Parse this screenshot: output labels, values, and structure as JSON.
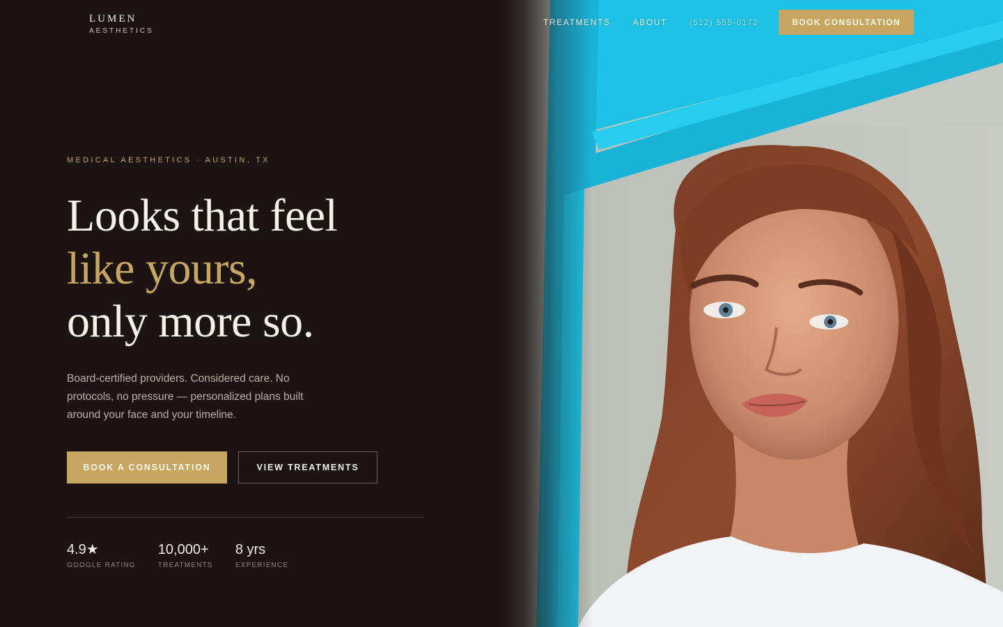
{
  "brand": {
    "name": "LUMEN",
    "subtitle": "AESTHETICS"
  },
  "nav": {
    "items": [
      {
        "label": "TREATMENTS"
      },
      {
        "label": "ABOUT"
      },
      {
        "label": "(512) 555-0172"
      }
    ],
    "cta_label": "BOOK CONSULTATION"
  },
  "hero": {
    "eyebrow": "MEDICAL AESTHETICS · AUSTIN, TX",
    "headline_line1": "Looks that feel",
    "headline_line2": "like yours,",
    "headline_line3": "only more so.",
    "lede": "Board-certified providers. Considered care. No protocols, no pressure — personalized plans built around your face and your timeline.",
    "primary_button": "BOOK A CONSULTATION",
    "secondary_button": "VIEW TREATMENTS"
  },
  "stats": [
    {
      "value": "4.9★",
      "label": "GOOGLE RATING"
    },
    {
      "value": "10,000+",
      "label": "TREATMENTS"
    },
    {
      "value": "8 yrs",
      "label": "EXPERIENCE"
    }
  ],
  "colors": {
    "background": "#1b1412",
    "accent_gold": "#c8a660",
    "photo_frame_blue": "#1cc3e6"
  },
  "icons": {
    "hero_image": "woman-portrait-image"
  }
}
